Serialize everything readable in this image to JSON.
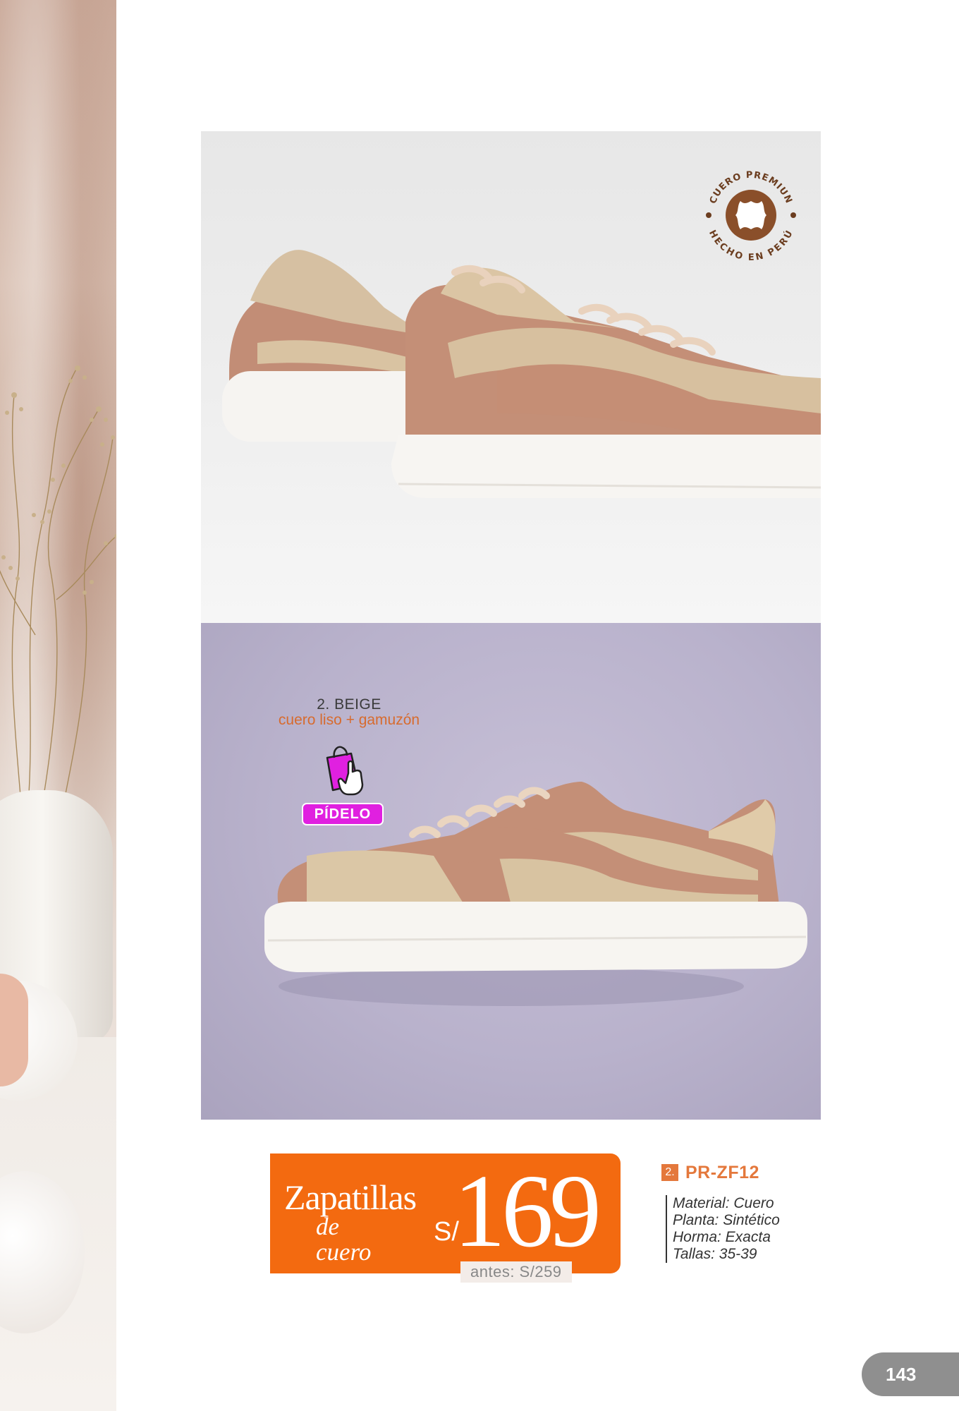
{
  "badge": {
    "top_text": "CUERO PREMIUN",
    "bottom_text": "HECHO EN PERÚ",
    "icon": "leather-hide-icon"
  },
  "variant": {
    "name": "2. BEIGE",
    "material": "cuero liso + gamuzón"
  },
  "order_button": {
    "label": "PÍDELO",
    "icon": "shopping-bag-hand-icon"
  },
  "price_box": {
    "title_line1": "Zapatillas",
    "title_line2": "de cuero",
    "currency": "S/",
    "price": "169",
    "before": "antes: S/259"
  },
  "product": {
    "number": "2.",
    "code": "PR-ZF12",
    "specs": [
      "Material: Cuero",
      "Planta: Sintético",
      "Horma: Exacta",
      "Tallas: 35-39"
    ]
  },
  "page_number": "143",
  "colors": {
    "accent_orange": "#f36a10",
    "pidelo_magenta": "#e020e0",
    "badge_brown": "#8a4f2a"
  }
}
